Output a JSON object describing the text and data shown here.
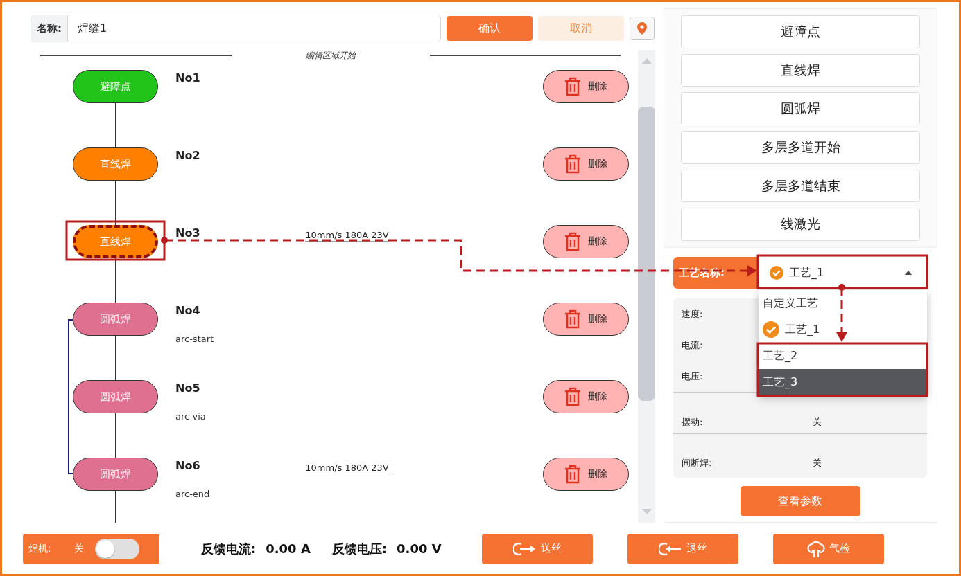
{
  "name_field": {
    "label": "名称:",
    "value": "焊缝1"
  },
  "confirm_button": "确认",
  "cancel_button": "取消",
  "editor": {
    "header": "编辑区域开始",
    "nodes": [
      {
        "kind": "obstacle",
        "label": "避障点",
        "number": "No1",
        "delete": "删除",
        "selected": false
      },
      {
        "kind": "line",
        "label": "直线焊",
        "number": "No2",
        "delete": "删除",
        "selected": false
      },
      {
        "kind": "line",
        "label": "直线焊",
        "number": "No3",
        "params": "10mm/s 180A 23V",
        "delete": "删除",
        "selected": true
      },
      {
        "kind": "arc",
        "label": "圆弧焊",
        "number": "No4",
        "sub": "arc-start",
        "delete": "删除",
        "selected": false
      },
      {
        "kind": "arc",
        "label": "圆弧焊",
        "number": "No5",
        "sub": "arc-via",
        "delete": "删除",
        "selected": false
      },
      {
        "kind": "arc",
        "label": "圆弧焊",
        "number": "No6",
        "sub": "arc-end",
        "params": "10mm/s 180A 23V",
        "delete": "删除",
        "selected": false
      }
    ]
  },
  "point_types": [
    "避障点",
    "直线焊",
    "圆弧焊",
    "多层多道开始",
    "多层多道结束",
    "线激光"
  ],
  "process": {
    "label": "工艺名称:",
    "value": "工艺_1",
    "expanded": true,
    "params": [
      {
        "label": "速度:"
      },
      {
        "label": "电流:"
      },
      {
        "label": "电压:"
      },
      {
        "label": "摆动:",
        "value": "关"
      },
      {
        "label": "间断焊:",
        "value": "关"
      }
    ],
    "options": [
      {
        "label": "自定义工艺",
        "selected": false,
        "highlighted": false
      },
      {
        "label": "工艺_1",
        "selected": true,
        "highlighted": false
      },
      {
        "label": "工艺_2",
        "selected": false,
        "highlighted": false
      },
      {
        "label": "工艺_3",
        "selected": false,
        "highlighted": true
      }
    ],
    "view_button": "查看参数"
  },
  "footer": {
    "welder_label": "焊机:",
    "welder_state": "关",
    "welder_on": false,
    "current_label": "反馈电流:",
    "current_value": "0.00 A",
    "voltage_label": "反馈电压:",
    "voltage_value": "0.00 V",
    "buttons": [
      {
        "kind": "feed",
        "label": "送丝"
      },
      {
        "kind": "retract",
        "label": "退丝"
      },
      {
        "kind": "gas",
        "label": "气检"
      }
    ]
  }
}
